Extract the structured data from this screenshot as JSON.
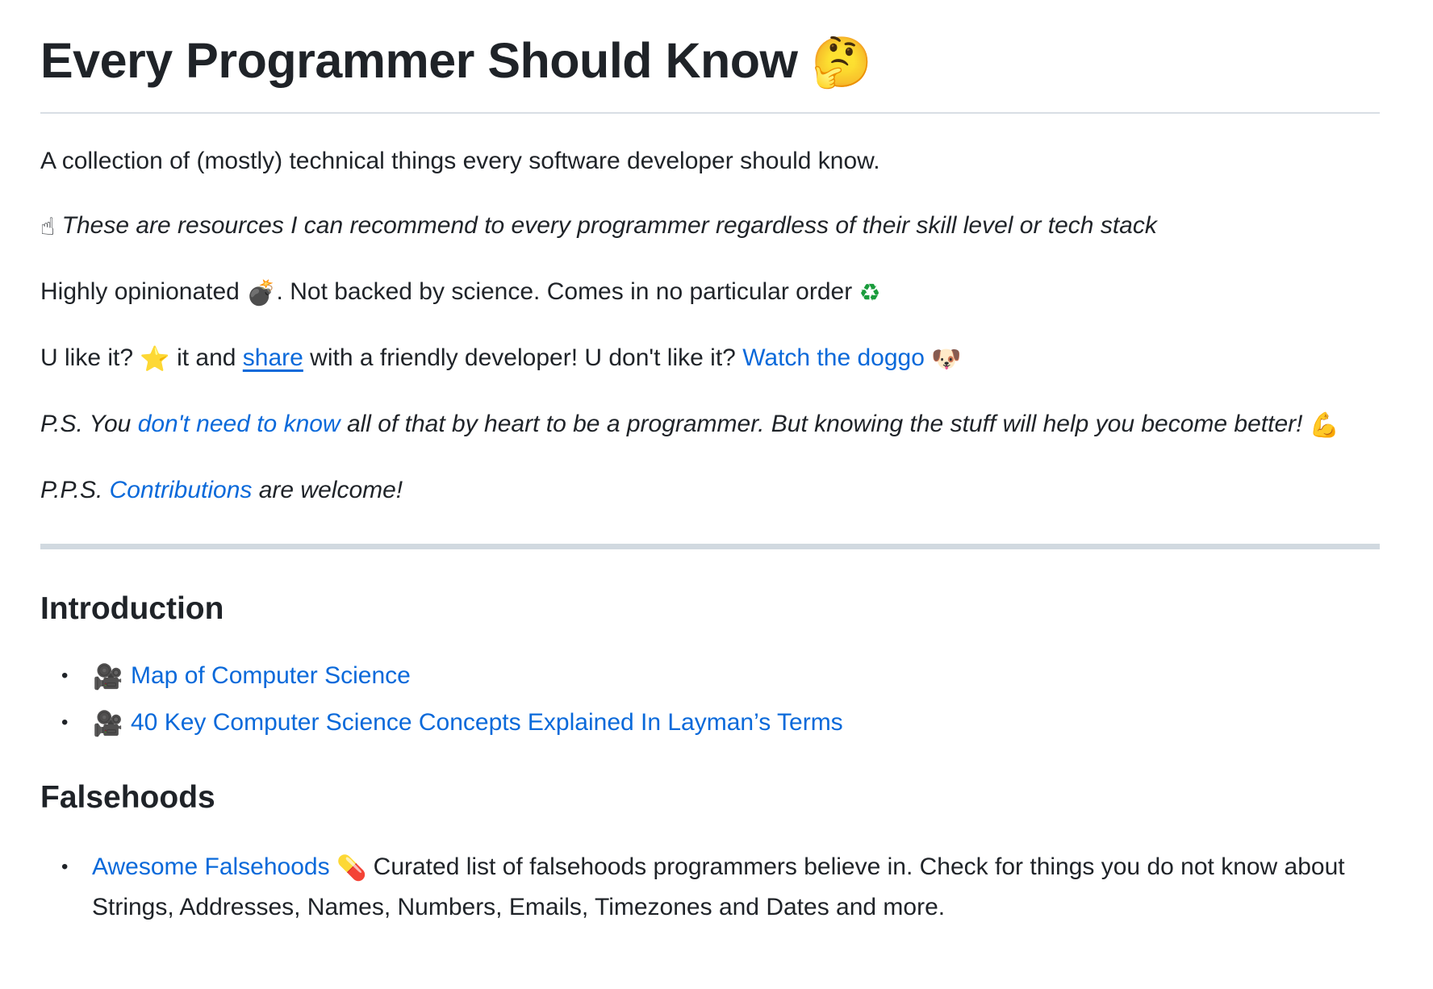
{
  "header": {
    "title": "Every Programmer Should Know",
    "title_emoji": "🤔"
  },
  "intro": {
    "description": "A collection of (mostly) technical things every software developer should know.",
    "finger_emoji": "☝",
    "recommend_text": "These are resources I can recommend to every programmer regardless of their skill level or tech stack",
    "opinion_1": "Highly opinionated ",
    "bomb_emoji": "💣",
    "opinion_2": ". Not backed by science. Comes in no particular order ",
    "recycle_emoji": "♻",
    "like_1": "U like it? ",
    "star_emoji": "⭐",
    "like_2": " it and ",
    "share_link": "share",
    "like_3": " with a friendly developer! U don't like it? ",
    "doggo_link": "Watch the doggo",
    "dog_emoji": "🐶",
    "ps_1": "P.S. You ",
    "ps_link": "don't need to know",
    "ps_2": " all of that by heart to be a programmer. But knowing the stuff will help you become better! ",
    "muscle_emoji": "💪",
    "pps_1": "P.P.S. ",
    "pps_link": "Contributions",
    "pps_2": " are welcome!"
  },
  "sections": {
    "introduction": {
      "heading": "Introduction",
      "items": [
        {
          "icon": "🎥",
          "label": "Map of Computer Science"
        },
        {
          "icon": "🎥",
          "label": "40 Key Computer Science Concepts Explained In Layman’s Terms"
        }
      ]
    },
    "falsehoods": {
      "heading": "Falsehoods",
      "items": [
        {
          "label": "Awesome Falsehoods",
          "icon": "💊",
          "description": " Curated list of falsehoods programmers believe in. Check for things you do not know about Strings, Addresses, Names, Numbers, Emails, Timezones and Dates and more."
        }
      ]
    }
  },
  "list_bullet": "•",
  "colors": {
    "text": "#1f2328",
    "link": "#0969da",
    "rule": "#d8dee4",
    "thick_rule": "#d1d9e0"
  }
}
